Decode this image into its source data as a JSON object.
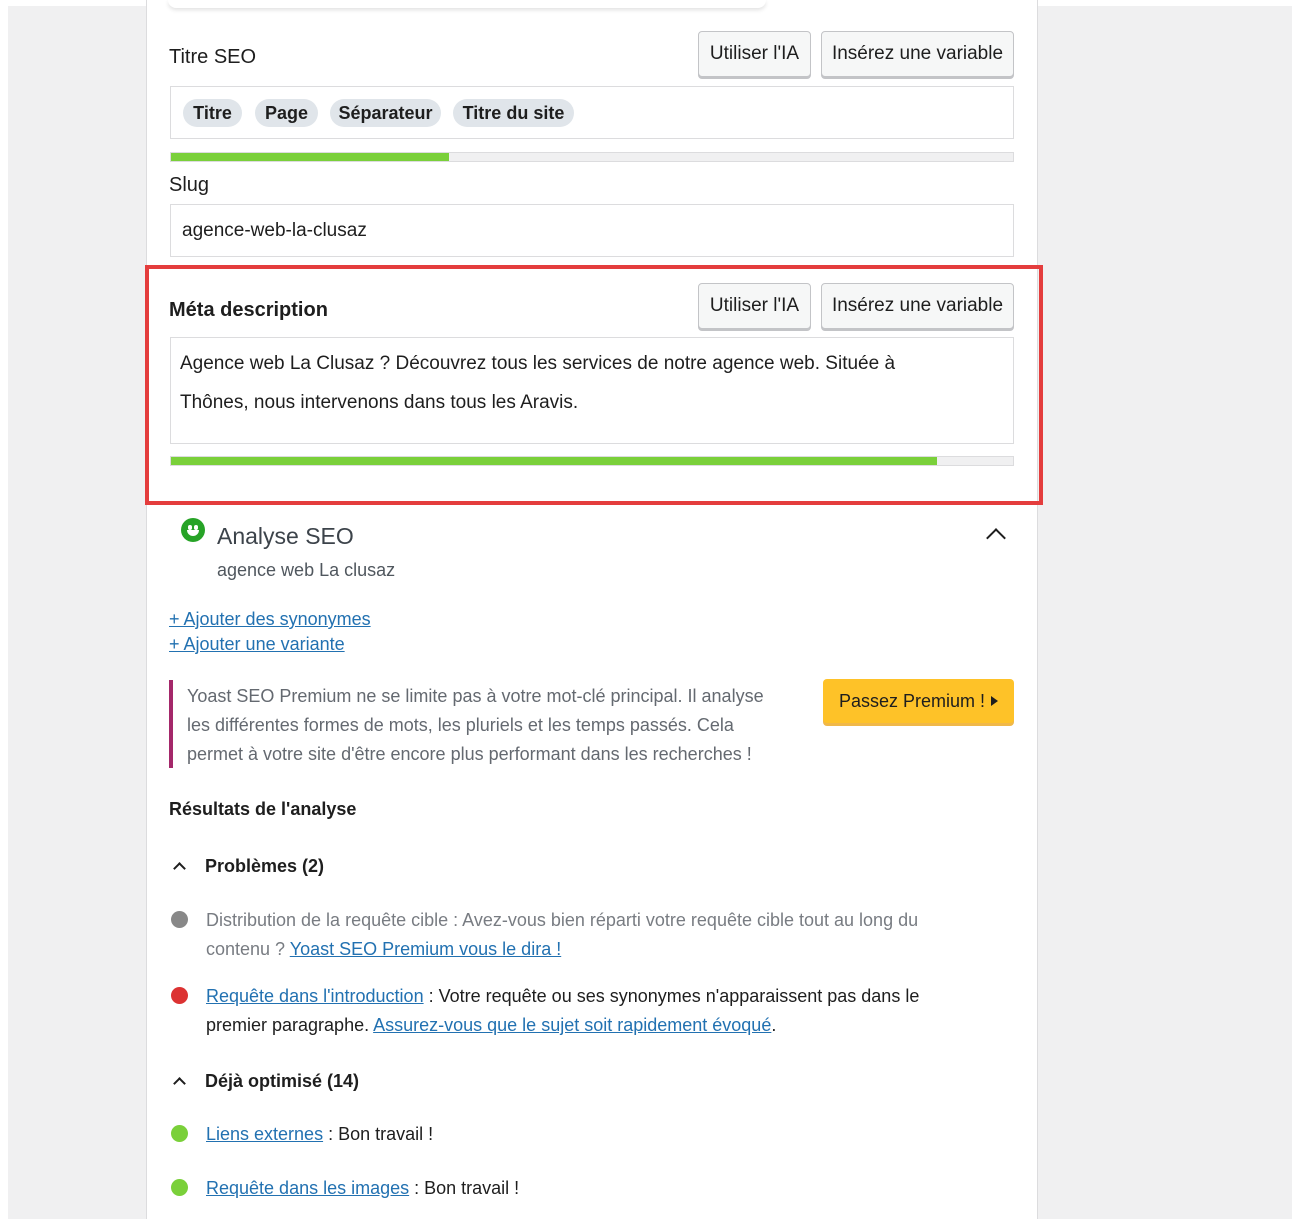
{
  "seo_title": {
    "label": "Titre SEO",
    "ai_button": "Utiliser l'IA",
    "variable_button": "Insérez une variable",
    "chips": [
      "Titre",
      "Page",
      "Séparateur",
      "Titre du site"
    ],
    "progress": 0.33
  },
  "slug": {
    "label": "Slug",
    "value": "agence-web-la-clusaz"
  },
  "meta": {
    "label": "Méta description",
    "ai_button": "Utiliser l'IA",
    "variable_button": "Insérez une variable",
    "line1": "Agence web La Clusaz ? Découvrez tous les services de notre agence web. Située à",
    "line2": "Thônes, nous intervenons dans tous les Aravis.",
    "progress": 0.91
  },
  "colors": {
    "highlight": "#e43d3d",
    "progress_good": "#7ad03a",
    "link": "#2271b1",
    "premium": "#fec228",
    "good": "#7ad03a",
    "bad": "#dc3232",
    "neutral": "#888888"
  },
  "analysis": {
    "title": "Analyse SEO",
    "keyphrase": "agence web La clusaz",
    "status_icon": "smiley-icon",
    "add_synonyms": "+ Ajouter des synonymes",
    "add_variant": "+ Ajouter une variante",
    "upsell_line1": "Yoast SEO Premium ne se limite pas à votre mot-clé principal. Il analyse",
    "upsell_line2": "les différentes formes de mots, les pluriels et les temps passés. Cela",
    "upsell_line3": "permet à votre site d'être encore plus performant dans les recherches !",
    "premium_button": "Passez Premium !",
    "results_heading": "Résultats de l'analyse",
    "problems_heading": "Problèmes (2)",
    "problem1_text": "Distribution de la requête cible : Avez-vous bien réparti votre requête cible tout au long du",
    "problem1_text2": "contenu ? ",
    "problem1_link": "Yoast SEO Premium vous le dira !",
    "problem2_link": "Requête dans l'introduction",
    "problem2_text": " : Votre requête ou ses synonymes n'apparaissent pas dans le",
    "problem2_text2": "premier paragraphe. ",
    "problem2_link2": "Assurez-vous que le sujet soit rapidement évoqué",
    "problem2_end": ".",
    "optimized_heading": "Déjà optimisé (14)",
    "good1_link": "Liens externes",
    "good1_text": " : Bon travail !",
    "good2_link": "Requête dans les images",
    "good2_text": " : Bon travail !"
  }
}
